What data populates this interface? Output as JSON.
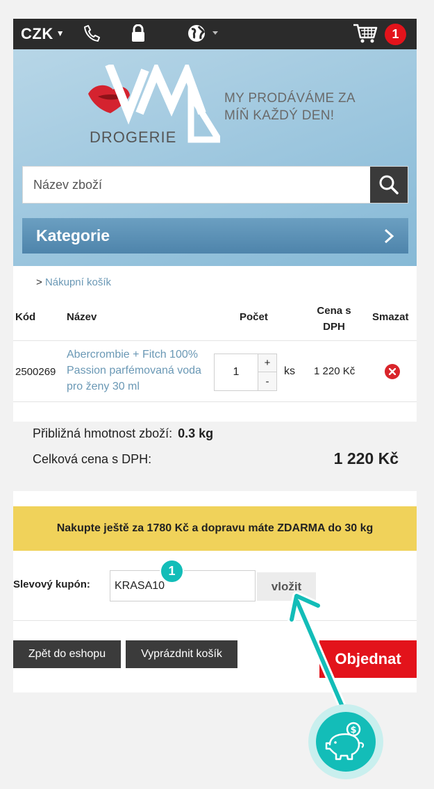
{
  "topbar": {
    "currency": "CZK",
    "cart_count": "1"
  },
  "header": {
    "logo_text": "DROGERIE",
    "slogan_line1": "MY PRODÁVÁME ZA",
    "slogan_line2": "MÍŇ KAŽDÝ DEN!"
  },
  "search": {
    "placeholder": "Název zboží"
  },
  "categories": {
    "label": "Kategorie"
  },
  "breadcrumb": {
    "separator": ">",
    "current": "Nákupní košík"
  },
  "table": {
    "headers": {
      "code": "Kód",
      "name": "Název",
      "qty": "Počet",
      "price_line1": "Cena s",
      "price_line2": "DPH",
      "delete": "Smazat"
    },
    "rows": [
      {
        "code": "2500269",
        "name": "Abercrombie + Fitch 100% Passion parfémovaná voda pro ženy 30 ml",
        "qty": "1",
        "plus": "+",
        "minus": "-",
        "unit": "ks",
        "price": "1 220 Kč"
      }
    ]
  },
  "summary": {
    "weight_label": "Přibližná hmotnost zboží:",
    "weight_value": "0.3 kg",
    "total_label": "Celková cena s DPH:",
    "total_value": "1 220 Kč"
  },
  "notice": "Nakupte ještě za 1780 Kč a dopravu máte ZDARMA do 30 kg",
  "coupon": {
    "label": "Slevový kupón:",
    "value": "KRASA10",
    "button": "vložit",
    "step": "1"
  },
  "actions": {
    "back": "Zpět do eshopu",
    "empty": "Vyprázdnit košík",
    "order": "Objednat"
  },
  "colors": {
    "accent_red": "#e3131b",
    "link_blue": "#6a98b5",
    "notice_yellow": "#f0d25a",
    "annotation_teal": "#13bdb8"
  }
}
